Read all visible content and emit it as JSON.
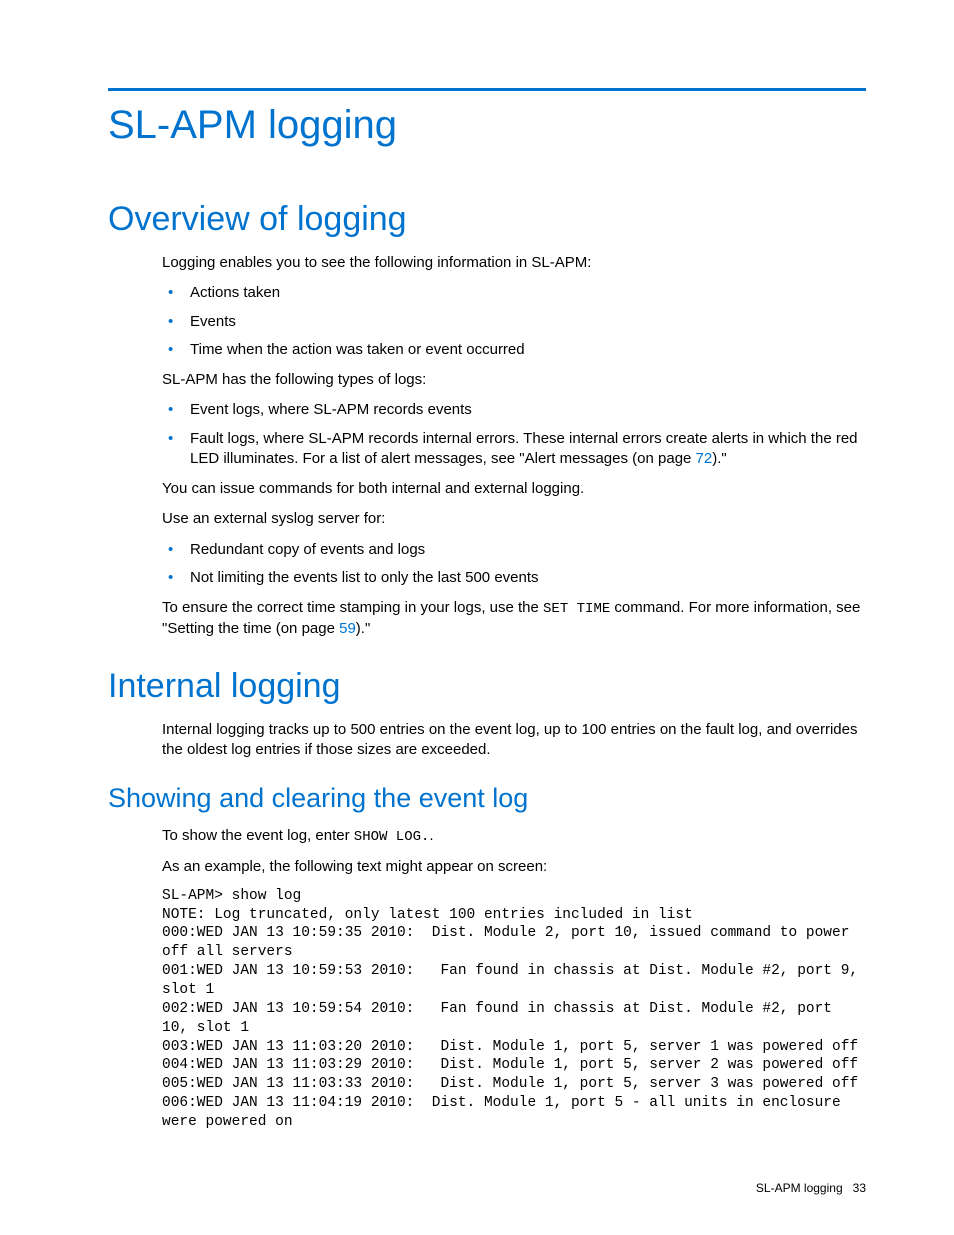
{
  "chapter_title": "SL-APM logging",
  "overview": {
    "title": "Overview of logging",
    "intro": "Logging enables you to see the following information in SL-APM:",
    "list1": [
      "Actions taken",
      "Events",
      "Time when the action was taken or event occurred"
    ],
    "p2": "SL-APM has the following types of logs:",
    "list2_item1": "Event logs, where SL-APM records events",
    "list2_item2_pre": "Fault logs, where SL-APM records internal errors. These internal errors create alerts in which the red LED illuminates. For a list of alert messages, see \"Alert messages (on page ",
    "list2_item2_link": "72",
    "list2_item2_post": ").\"",
    "p3": "You can issue commands for both internal and external logging.",
    "p4": "Use an external syslog server for:",
    "list3": [
      "Redundant copy of events and logs",
      "Not limiting the events list to only the last 500 events"
    ],
    "p5_pre": "To ensure the correct time stamping in your logs, use the ",
    "p5_cmd": "SET TIME",
    "p5_mid": " command. For more information, see \"Setting the time (on page ",
    "p5_link": "59",
    "p5_post": ").\""
  },
  "internal": {
    "title": "Internal logging",
    "p1": "Internal logging tracks up to 500 entries on the event log, up to 100 entries on the fault log, and overrides the oldest log entries if those sizes are exceeded."
  },
  "show_clear": {
    "title": "Showing and clearing the event log",
    "p1_pre": "To show the event log, enter ",
    "p1_cmd": "SHOW LOG.",
    "p1_post": ".",
    "p2": "As an example, the following text might appear on screen:",
    "code": "SL-APM> show log\nNOTE: Log truncated, only latest 100 entries included in list\n000:WED JAN 13 10:59:35 2010:  Dist. Module 2, port 10, issued command to power off all servers\n001:WED JAN 13 10:59:53 2010:   Fan found in chassis at Dist. Module #2, port 9, slot 1\n002:WED JAN 13 10:59:54 2010:   Fan found in chassis at Dist. Module #2, port 10, slot 1\n003:WED JAN 13 11:03:20 2010:   Dist. Module 1, port 5, server 1 was powered off\n004:WED JAN 13 11:03:29 2010:   Dist. Module 1, port 5, server 2 was powered off\n005:WED JAN 13 11:03:33 2010:   Dist. Module 1, port 5, server 3 was powered off\n006:WED JAN 13 11:04:19 2010:  Dist. Module 1, port 5 - all units in enclosure were powered on"
  },
  "footer": {
    "label": "SL-APM logging",
    "pagenum": "33"
  }
}
